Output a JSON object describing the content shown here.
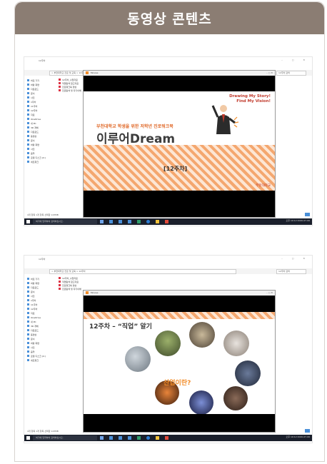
{
  "header": {
    "title": "동영상 콘텐츠"
  },
  "explorer": {
    "title_text": "12주차",
    "address_path": "> 부천대학교 진로 및 교육 > 12주차",
    "search_placeholder": "12주차 검색",
    "nav_items": [
      "바로 가기",
      "바탕 화면",
      "다운로드",
      "문서",
      "사진",
      "1주차",
      "11주차",
      "12주차",
      "자료",
      "OneDrive",
      "내 PC",
      "3D 개체",
      "다운로드",
      "동영상",
      "문서",
      "바탕 화면",
      "사진",
      "음악",
      "로컬 디스크 (C:)",
      "네트워크"
    ],
    "files": [
      "12주차_수업자료",
      "직업탐색 참고자료",
      "진로워크북 영상",
      "진로탐색 및 자기이해"
    ],
    "status_text": "4개 항목    1개 항목 선택함 143MB",
    "taskbar_search": "여기에 입력하여 검색하십시오.",
    "clock": "오후 10:12  2020-07-06"
  },
  "player1": {
    "window_title": "Movies",
    "slide": {
      "tagline_line1": "Drawing My Story!",
      "tagline_line2": "Find My Vision!",
      "subtitle": "부천대학교 학생을 위한 저학년 진로워크북",
      "title": "이루어Dream",
      "week": "[12주차]",
      "logo": "부천대학교"
    }
  },
  "player2": {
    "window_title": "Movies",
    "slide": {
      "title": "12주차 – “직업” 알기",
      "center": "산업이란?"
    }
  },
  "colors": {
    "header_bg": "#8b7d73",
    "accent_orange": "#f28c28",
    "stripe_orange": "#f4a76f"
  }
}
